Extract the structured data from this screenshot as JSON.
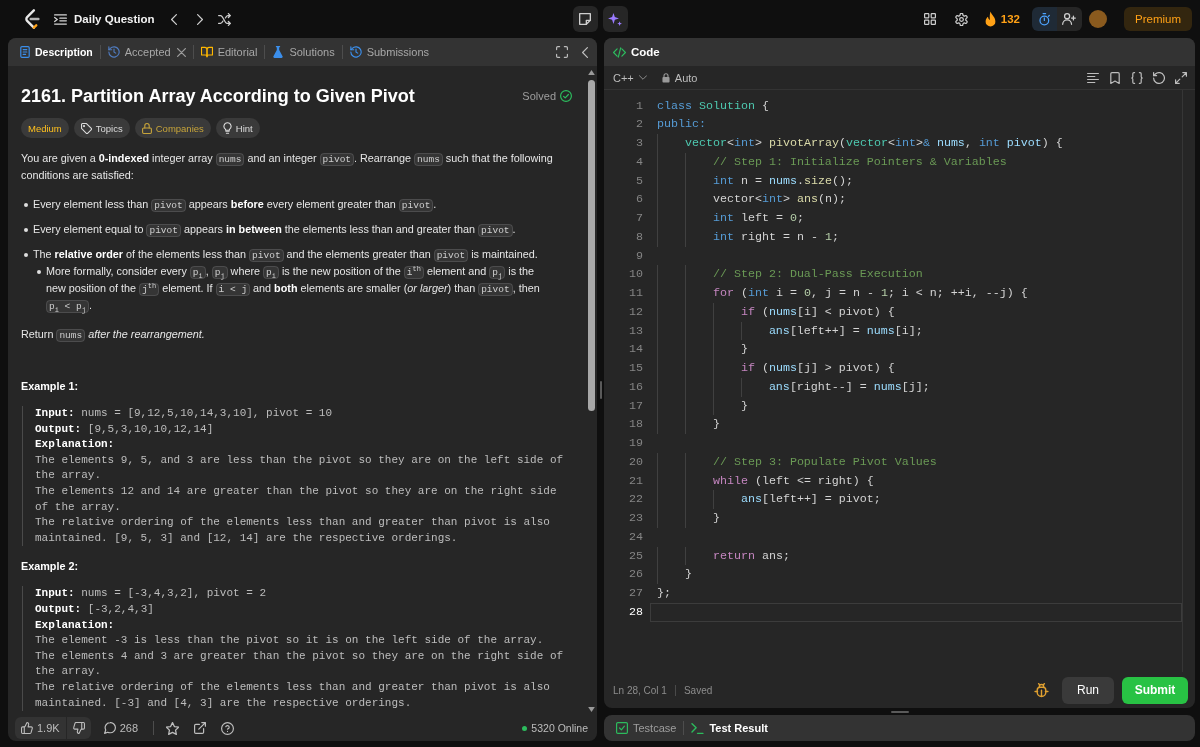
{
  "top_bar": {
    "title": "Daily Question",
    "streak": "132",
    "premium": "Premium"
  },
  "description_panel": {
    "tabs": [
      {
        "label": "Description",
        "kind": "description",
        "selected": true,
        "closable": false
      },
      {
        "label": "Accepted",
        "kind": "accepted",
        "selected": false,
        "closable": true
      },
      {
        "label": "Editorial",
        "kind": "editorial",
        "selected": false,
        "closable": false
      },
      {
        "label": "Solutions",
        "kind": "solutions",
        "selected": false,
        "closable": false
      },
      {
        "label": "Submissions",
        "kind": "submissions",
        "selected": false,
        "closable": false
      }
    ],
    "title": "2161. Partition Array According to Given Pivot",
    "status": "Solved",
    "tags": [
      {
        "label": "Medium",
        "kind": "difficulty"
      },
      {
        "label": "Topics",
        "kind": "topics"
      },
      {
        "label": "Companies",
        "kind": "companies"
      },
      {
        "label": "Hint",
        "kind": "hint"
      }
    ],
    "content": [
      {
        "kind": "paragraph",
        "parts": [
          {
            "kind": "text",
            "text": "You are given a **0-indexed** integer array "
          },
          {
            "kind": "code",
            "text": "nums"
          },
          {
            "kind": "text",
            "text": " and an integer "
          },
          {
            "kind": "code",
            "text": "pivot"
          },
          {
            "kind": "text",
            "text": ". Rearrange "
          },
          {
            "kind": "code",
            "text": "nums"
          },
          {
            "kind": "text",
            "text": " such that the following conditions are satisfied:"
          }
        ]
      },
      {
        "kind": "list",
        "items": [
          {
            "parts": [
              {
                "kind": "text",
                "text": "Every element less than "
              },
              {
                "kind": "code",
                "text": "pivot"
              },
              {
                "kind": "text",
                "text": " appears **before** every element greater than "
              },
              {
                "kind": "code",
                "text": "pivot"
              },
              {
                "kind": "text",
                "text": "."
              }
            ]
          },
          {
            "parts": [
              {
                "kind": "text",
                "text": "Every element equal to "
              },
              {
                "kind": "code",
                "text": "pivot"
              },
              {
                "kind": "text",
                "text": " appears **in between** the elements less than and greater than "
              },
              {
                "kind": "code",
                "text": "pivot"
              },
              {
                "kind": "text",
                "text": "."
              }
            ]
          },
          {
            "parts": [
              {
                "kind": "text",
                "text": "The **relative order** of the elements less than "
              },
              {
                "kind": "code",
                "text": "pivot"
              },
              {
                "kind": "text",
                "text": " and the elements greater than "
              },
              {
                "kind": "code",
                "text": "pivot"
              },
              {
                "kind": "text",
                "text": " is maintained."
              }
            ],
            "children": [
              {
                "parts": [
                  {
                    "kind": "text",
                    "text": "More formally, consider every "
                  },
                  {
                    "kind": "code",
                    "text": "p$_{i}$"
                  },
                  {
                    "kind": "text",
                    "text": ", "
                  },
                  {
                    "kind": "code",
                    "text": "p$_{j}$"
                  },
                  {
                    "kind": "text",
                    "text": " where "
                  },
                  {
                    "kind": "code",
                    "text": "p$_{i}$"
                  },
                  {
                    "kind": "text",
                    "text": " is the new position of the "
                  },
                  {
                    "kind": "code",
                    "text": "i$^{th}$"
                  },
                  {
                    "kind": "text",
                    "text": " element and "
                  },
                  {
                    "kind": "code",
                    "text": "p$_{j}$"
                  },
                  {
                    "kind": "text",
                    "text": " is the new position of the "
                  },
                  {
                    "kind": "code",
                    "text": "j$^{th}$"
                  },
                  {
                    "kind": "text",
                    "text": " element. If "
                  },
                  {
                    "kind": "code",
                    "text": "i < j"
                  },
                  {
                    "kind": "text",
                    "text": " and **both** elements are smaller (*or larger*) than "
                  },
                  {
                    "kind": "code",
                    "text": "pivot"
                  },
                  {
                    "kind": "text",
                    "text": ", then "
                  },
                  {
                    "kind": "code",
                    "text": "p$_{i}$ < p$_{j}$"
                  },
                  {
                    "kind": "text",
                    "text": "."
                  }
                ]
              }
            ]
          }
        ]
      },
      {
        "kind": "paragraph",
        "parts": [
          {
            "kind": "text",
            "text": "Return "
          },
          {
            "kind": "code",
            "text": "nums"
          },
          {
            "kind": "text",
            "text": " *after the rearrangement.*"
          }
        ]
      },
      {
        "kind": "example",
        "title": "Example 1:",
        "lines": [
          "**Input:** nums = [9,12,5,10,14,3,10], pivot = 10",
          "**Output:** [9,5,3,10,10,12,14]"
        ],
        "explanation_title": "Explanation:",
        "explanation": [
          "The elements 9, 5, and 3 are less than the pivot so they are on the left side of the array.",
          "The elements 12 and 14 are greater than the pivot so they are on the right side of the array.",
          "The relative ordering of the elements less than and greater than pivot is also maintained. [9, 5, 3] and [12, 14] are the respective orderings."
        ]
      },
      {
        "kind": "example",
        "title": "Example 2:",
        "lines": [
          "**Input:** nums = [-3,4,3,2], pivot = 2",
          "**Output:** [-3,2,4,3]"
        ],
        "explanation_title": "Explanation:",
        "explanation": [
          "The element -3 is less than the pivot so it is on the left side of the array.",
          "The elements 4 and 3 are greater than the pivot so they are on the right side of the array.",
          "The relative ordering of the elements less than and greater than pivot is also maintained. [-3] and [4, 3] are the respective orderings."
        ]
      }
    ],
    "footer": {
      "likes": "1.9K",
      "comments": "268",
      "online": "5320 Online"
    }
  },
  "code_panel": {
    "title": "Code",
    "language": "C++",
    "mode": "Auto",
    "lines": [
      {
        "number": "1",
        "current": false,
        "tokens": [
          {
            "text": "class",
            "kind": "keyword"
          },
          {
            "text": " Solution",
            "kind": "type"
          },
          {
            "text": " {",
            "kind": "plain"
          }
        ]
      },
      {
        "number": "2",
        "current": false,
        "tokens": [
          {
            "text": "public:",
            "kind": "keyword"
          }
        ]
      },
      {
        "number": "3",
        "current": false,
        "tokens": [
          {
            "text": "    vector",
            "kind": "type"
          },
          {
            "text": "<",
            "kind": "plain"
          },
          {
            "text": "int",
            "kind": "keyword"
          },
          {
            "text": "> ",
            "kind": "plain"
          },
          {
            "text": "pivotArray",
            "kind": "function"
          },
          {
            "text": "(",
            "kind": "plain"
          },
          {
            "text": "vector",
            "kind": "type"
          },
          {
            "text": "<",
            "kind": "plain"
          },
          {
            "text": "int",
            "kind": "keyword"
          },
          {
            "text": ">",
            "kind": "plain"
          },
          {
            "text": "&",
            "kind": "keyword"
          },
          {
            "text": " nums",
            "kind": "variable"
          },
          {
            "text": ", ",
            "kind": "plain"
          },
          {
            "text": "int",
            "kind": "keyword"
          },
          {
            "text": " pivot",
            "kind": "variable"
          },
          {
            "text": ") {",
            "kind": "plain"
          }
        ]
      },
      {
        "number": "4",
        "current": false,
        "tokens": [
          {
            "text": "        // Step 1: Initialize Pointers & Variables",
            "kind": "comment"
          }
        ]
      },
      {
        "number": "5",
        "current": false,
        "tokens": [
          {
            "text": "        int",
            "kind": "keyword"
          },
          {
            "text": " n = ",
            "kind": "plain"
          },
          {
            "text": "nums",
            "kind": "variable"
          },
          {
            "text": ".",
            "kind": "plain"
          },
          {
            "text": "size",
            "kind": "function"
          },
          {
            "text": "();",
            "kind": "plain"
          }
        ]
      },
      {
        "number": "6",
        "current": false,
        "tokens": [
          {
            "text": "        vector<",
            "kind": "plain"
          },
          {
            "text": "int",
            "kind": "keyword"
          },
          {
            "text": "> ",
            "kind": "plain"
          },
          {
            "text": "ans",
            "kind": "function"
          },
          {
            "text": "(n);",
            "kind": "plain"
          }
        ]
      },
      {
        "number": "7",
        "current": false,
        "tokens": [
          {
            "text": "        int",
            "kind": "keyword"
          },
          {
            "text": " left = ",
            "kind": "plain"
          },
          {
            "text": "0",
            "kind": "number"
          },
          {
            "text": ";",
            "kind": "plain"
          }
        ]
      },
      {
        "number": "8",
        "current": false,
        "tokens": [
          {
            "text": "        int",
            "kind": "keyword"
          },
          {
            "text": " right = n - ",
            "kind": "plain"
          },
          {
            "text": "1",
            "kind": "number"
          },
          {
            "text": ";",
            "kind": "plain"
          }
        ]
      },
      {
        "number": "9",
        "current": false
      },
      {
        "number": "10",
        "current": false,
        "tokens": [
          {
            "text": "        // Step 2: Dual-Pass Execution",
            "kind": "comment"
          }
        ]
      },
      {
        "number": "11",
        "current": false,
        "tokens": [
          {
            "text": "        for",
            "kind": "control"
          },
          {
            "text": " (",
            "kind": "plain"
          },
          {
            "text": "int",
            "kind": "keyword"
          },
          {
            "text": " i = ",
            "kind": "plain"
          },
          {
            "text": "0",
            "kind": "number"
          },
          {
            "text": ", j = n - ",
            "kind": "plain"
          },
          {
            "text": "1",
            "kind": "number"
          },
          {
            "text": "; i < n; ++i, --j) {",
            "kind": "plain"
          }
        ]
      },
      {
        "number": "12",
        "current": false,
        "tokens": [
          {
            "text": "            if",
            "kind": "control"
          },
          {
            "text": " (",
            "kind": "plain"
          },
          {
            "text": "nums",
            "kind": "variable"
          },
          {
            "text": "[i] < pivot) {",
            "kind": "plain"
          }
        ]
      },
      {
        "number": "13",
        "current": false,
        "tokens": [
          {
            "text": "                ans",
            "kind": "variable"
          },
          {
            "text": "[left++] = ",
            "kind": "plain"
          },
          {
            "text": "nums",
            "kind": "variable"
          },
          {
            "text": "[i];",
            "kind": "plain"
          }
        ]
      },
      {
        "number": "14",
        "current": false,
        "tokens": [
          {
            "text": "            }",
            "kind": "plain"
          }
        ]
      },
      {
        "number": "15",
        "current": false,
        "tokens": [
          {
            "text": "            if",
            "kind": "control"
          },
          {
            "text": " (",
            "kind": "plain"
          },
          {
            "text": "nums",
            "kind": "variable"
          },
          {
            "text": "[j] > pivot) {",
            "kind": "plain"
          }
        ]
      },
      {
        "number": "16",
        "current": false,
        "tokens": [
          {
            "text": "                ans",
            "kind": "variable"
          },
          {
            "text": "[right--] = ",
            "kind": "plain"
          },
          {
            "text": "nums",
            "kind": "variable"
          },
          {
            "text": "[j];",
            "kind": "plain"
          }
        ]
      },
      {
        "number": "17",
        "current": false,
        "tokens": [
          {
            "text": "            }",
            "kind": "plain"
          }
        ]
      },
      {
        "number": "18",
        "current": false,
        "tokens": [
          {
            "text": "        }",
            "kind": "plain"
          }
        ]
      },
      {
        "number": "19",
        "current": false
      },
      {
        "number": "20",
        "current": false,
        "tokens": [
          {
            "text": "        // Step 3: Populate Pivot Values",
            "kind": "comment"
          }
        ]
      },
      {
        "number": "21",
        "current": false,
        "tokens": [
          {
            "text": "        while",
            "kind": "control"
          },
          {
            "text": " (left <= right) {",
            "kind": "plain"
          }
        ]
      },
      {
        "number": "22",
        "current": false,
        "tokens": [
          {
            "text": "            ans",
            "kind": "variable"
          },
          {
            "text": "[left++] = pivot;",
            "kind": "plain"
          }
        ]
      },
      {
        "number": "23",
        "current": false,
        "tokens": [
          {
            "text": "        }",
            "kind": "plain"
          }
        ]
      },
      {
        "number": "24",
        "current": false
      },
      {
        "number": "25",
        "current": false,
        "tokens": [
          {
            "text": "        return",
            "kind": "control"
          },
          {
            "text": " ans;",
            "kind": "plain"
          }
        ]
      },
      {
        "number": "26",
        "current": false,
        "tokens": [
          {
            "text": "    }",
            "kind": "plain"
          }
        ]
      },
      {
        "number": "27",
        "current": false,
        "tokens": [
          {
            "text": "};",
            "kind": "plain"
          }
        ]
      },
      {
        "number": "28",
        "current": true
      }
    ],
    "cursor": "Ln 28, Col 1",
    "save_state": "Saved",
    "buttons": [
      {
        "label": "Run",
        "kind": "run"
      },
      {
        "label": "Submit",
        "kind": "submit"
      }
    ]
  },
  "result_panel": {
    "tabs": [
      {
        "label": "Testcase",
        "kind": "testcase",
        "selected": false
      },
      {
        "label": "Test Result",
        "kind": "result",
        "selected": true
      }
    ]
  }
}
